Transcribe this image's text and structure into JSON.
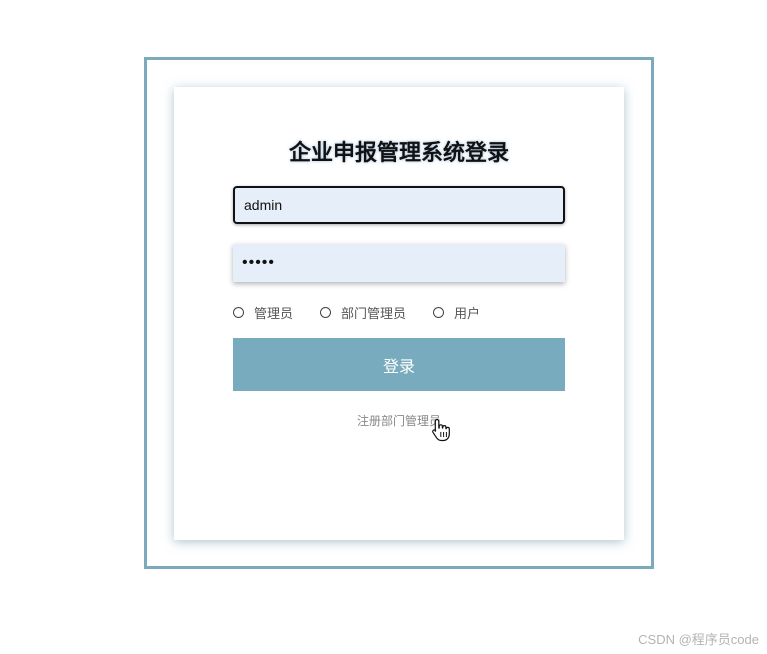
{
  "login": {
    "title": "企业申报管理系统登录",
    "username_value": "admin",
    "password_value": "•••••",
    "roles": [
      {
        "label": "管理员"
      },
      {
        "label": "部门管理员"
      },
      {
        "label": "用户"
      }
    ],
    "submit_label": "登录",
    "register_link": "注册部门管理员"
  },
  "watermark": "CSDN @程序员code",
  "colors": {
    "accent": "#79abbe",
    "frame": "#7aaabb",
    "input_bg": "#e6eef9"
  },
  "icons": {
    "cursor": "hand-pointer-icon"
  }
}
